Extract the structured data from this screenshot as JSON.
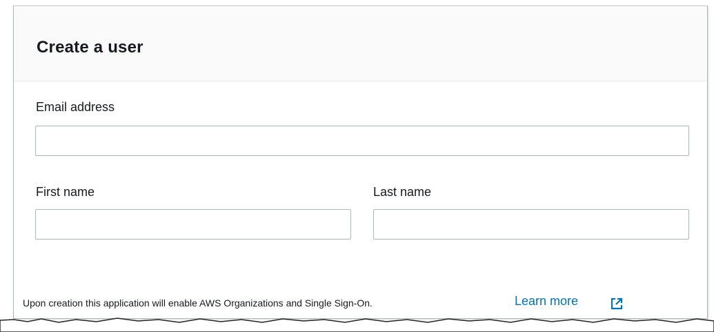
{
  "panel": {
    "title": "Create a user"
  },
  "form": {
    "email_label": "Email address",
    "email_value": "",
    "email_placeholder": "",
    "first_name_label": "First name",
    "first_name_value": "",
    "first_name_placeholder": "",
    "last_name_label": "Last name",
    "last_name_value": "",
    "last_name_placeholder": ""
  },
  "footer": {
    "note": "Upon creation this application will enable AWS Organizations and Single Sign-On.",
    "learn_more_label": "Learn more",
    "learn_more_icon": "external-link-icon"
  },
  "colors": {
    "link": "#0073bb",
    "border": "#aab7b8",
    "header_bg": "#fafafa"
  }
}
